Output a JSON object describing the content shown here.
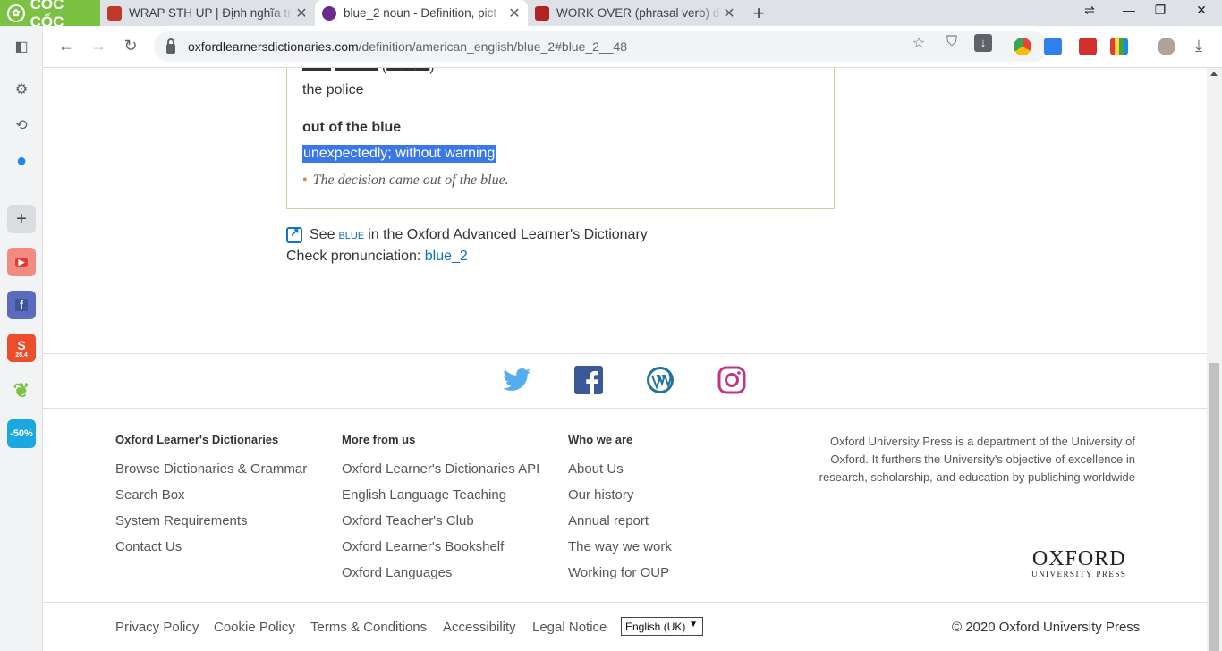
{
  "browser": {
    "brand": "CỐC CỐC",
    "tabs": [
      {
        "title": "WRAP STH UP | Định nghĩa tr",
        "favicon_color": "#c0392b"
      },
      {
        "title": "blue_2 noun - Definition, pict",
        "favicon_color": "#6c2a8c",
        "active": true
      },
      {
        "title": "WORK OVER (phrasal verb) d",
        "favicon_color": "#b22222"
      }
    ],
    "url_host": "oxfordlearnersdictionaries.com",
    "url_path": "/definition/american_english/blue_2#blue_2__48"
  },
  "sidebar": {
    "items": [
      {
        "name": "panel",
        "icon": "sidebar-panel-icon"
      },
      {
        "name": "settings",
        "icon": "gear-icon"
      },
      {
        "name": "history",
        "icon": "history-icon"
      },
      {
        "name": "messenger",
        "icon": "messenger-icon"
      },
      {
        "name": "add",
        "icon": "plus-icon"
      },
      {
        "name": "youtube",
        "icon": "youtube-icon"
      },
      {
        "name": "facebook",
        "icon": "facebook-icon"
      },
      {
        "name": "shopee",
        "icon": "shopee-icon",
        "label": "28.4"
      },
      {
        "name": "coc-coc-search",
        "icon": "leaf-icon"
      },
      {
        "name": "tiki",
        "icon": "tiki-icon",
        "label": "-50%"
      }
    ]
  },
  "entry": {
    "cut_line": "the police",
    "idiom": "out of the blue",
    "idiom_def": "unexpectedly; without warning",
    "example": "The decision came out of the blue.",
    "see_prefix": "See",
    "see_word": "blue",
    "see_suffix": "in the Oxford Advanced Learner's Dictionary",
    "pron_label": "Check pronunciation:",
    "pron_link": "blue_2"
  },
  "footer": {
    "columns": [
      {
        "heading": "Oxford Learner's Dictionaries",
        "links": [
          "Browse Dictionaries & Grammar",
          "Search Box",
          "System Requirements",
          "Contact Us"
        ]
      },
      {
        "heading": "More from us",
        "links": [
          "Oxford Learner's Dictionaries API",
          "English Language Teaching",
          "Oxford Teacher's Club",
          "Oxford Learner's Bookshelf",
          "Oxford Languages"
        ]
      },
      {
        "heading": "Who we are",
        "links": [
          "About Us",
          "Our history",
          "Annual report",
          "The way we work",
          "Working for OUP"
        ]
      }
    ],
    "about": "Oxford University Press is a department of the University of Oxford. It furthers the University's objective of excellence in research, scholarship, and education by publishing worldwide",
    "logo_big": "OXFORD",
    "logo_small": "UNIVERSITY PRESS",
    "legal": [
      "Privacy Policy",
      "Cookie Policy",
      "Terms & Conditions",
      "Accessibility",
      "Legal Notice"
    ],
    "language": "English (UK)",
    "copyright": "© 2020 Oxford University Press"
  },
  "colors": {
    "highlight": "#3b78e7",
    "link": "#0b6fbf",
    "twitter": "#55acee",
    "facebook": "#3b5998",
    "wordpress": "#21759b",
    "instagram": "#c13584"
  }
}
